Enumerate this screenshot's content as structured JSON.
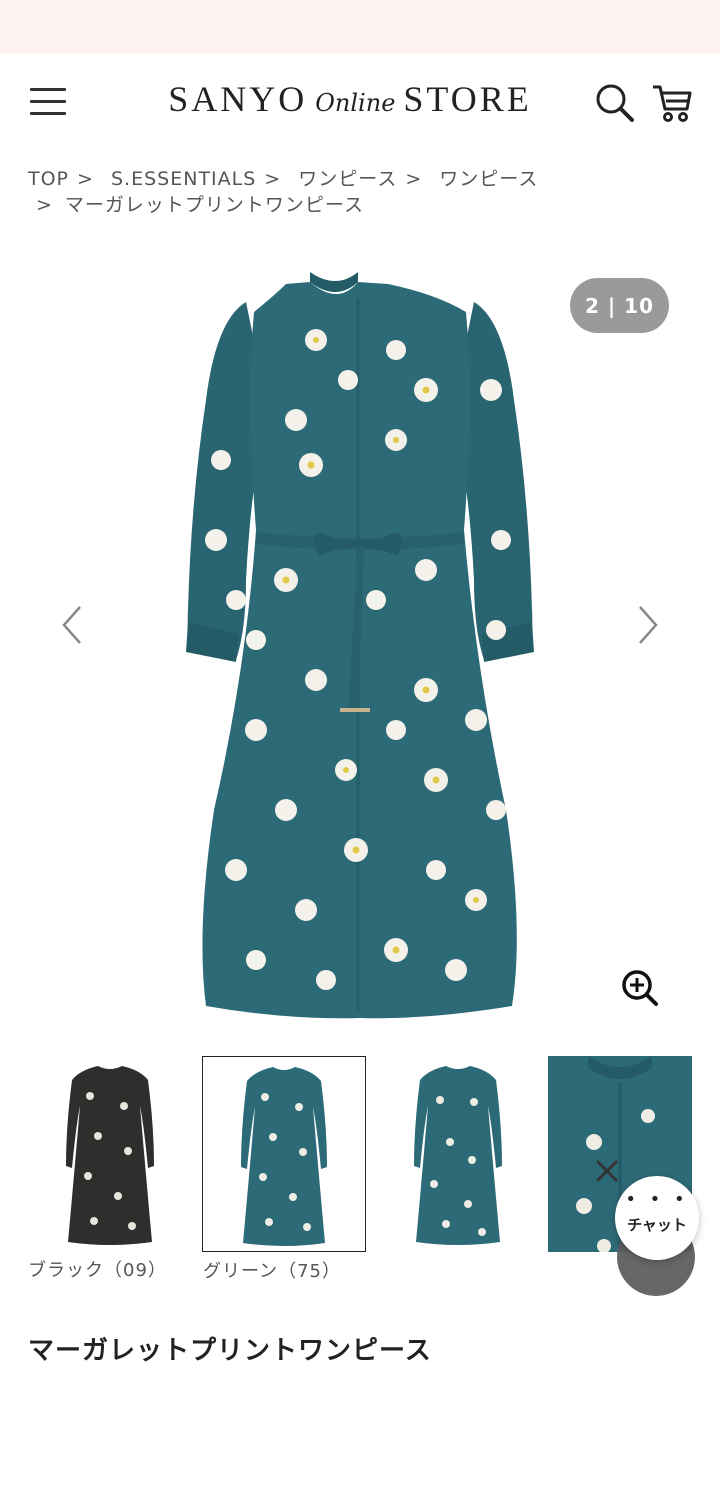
{
  "header": {
    "logo": {
      "word1": "SANYO",
      "word2": "Online",
      "word3": "STORE"
    }
  },
  "breadcrumb": {
    "items": [
      "TOP",
      "S.ESSENTIALS",
      "ワンピース",
      "ワンピース",
      "マーガレットプリントワンピース"
    ],
    "separator": ">"
  },
  "gallery": {
    "counter": "2 | 10",
    "dress_color": "#2d6a77",
    "thumbnails": [
      {
        "label": "ブラック（09）",
        "color": "#2d2f2c"
      },
      {
        "label": "グリーン（75）",
        "color": "#2d6a77"
      },
      {
        "label": "",
        "color": "#2d6a77"
      },
      {
        "label": "",
        "color": "#2d6a77"
      }
    ]
  },
  "chat": {
    "label": "チャット",
    "dots": "• • •"
  },
  "product": {
    "title": "マーガレットプリントワンピース"
  },
  "colors": {
    "banner": "#fff3f1",
    "counter_bg": "#9a9a9a",
    "text": "#333333"
  }
}
